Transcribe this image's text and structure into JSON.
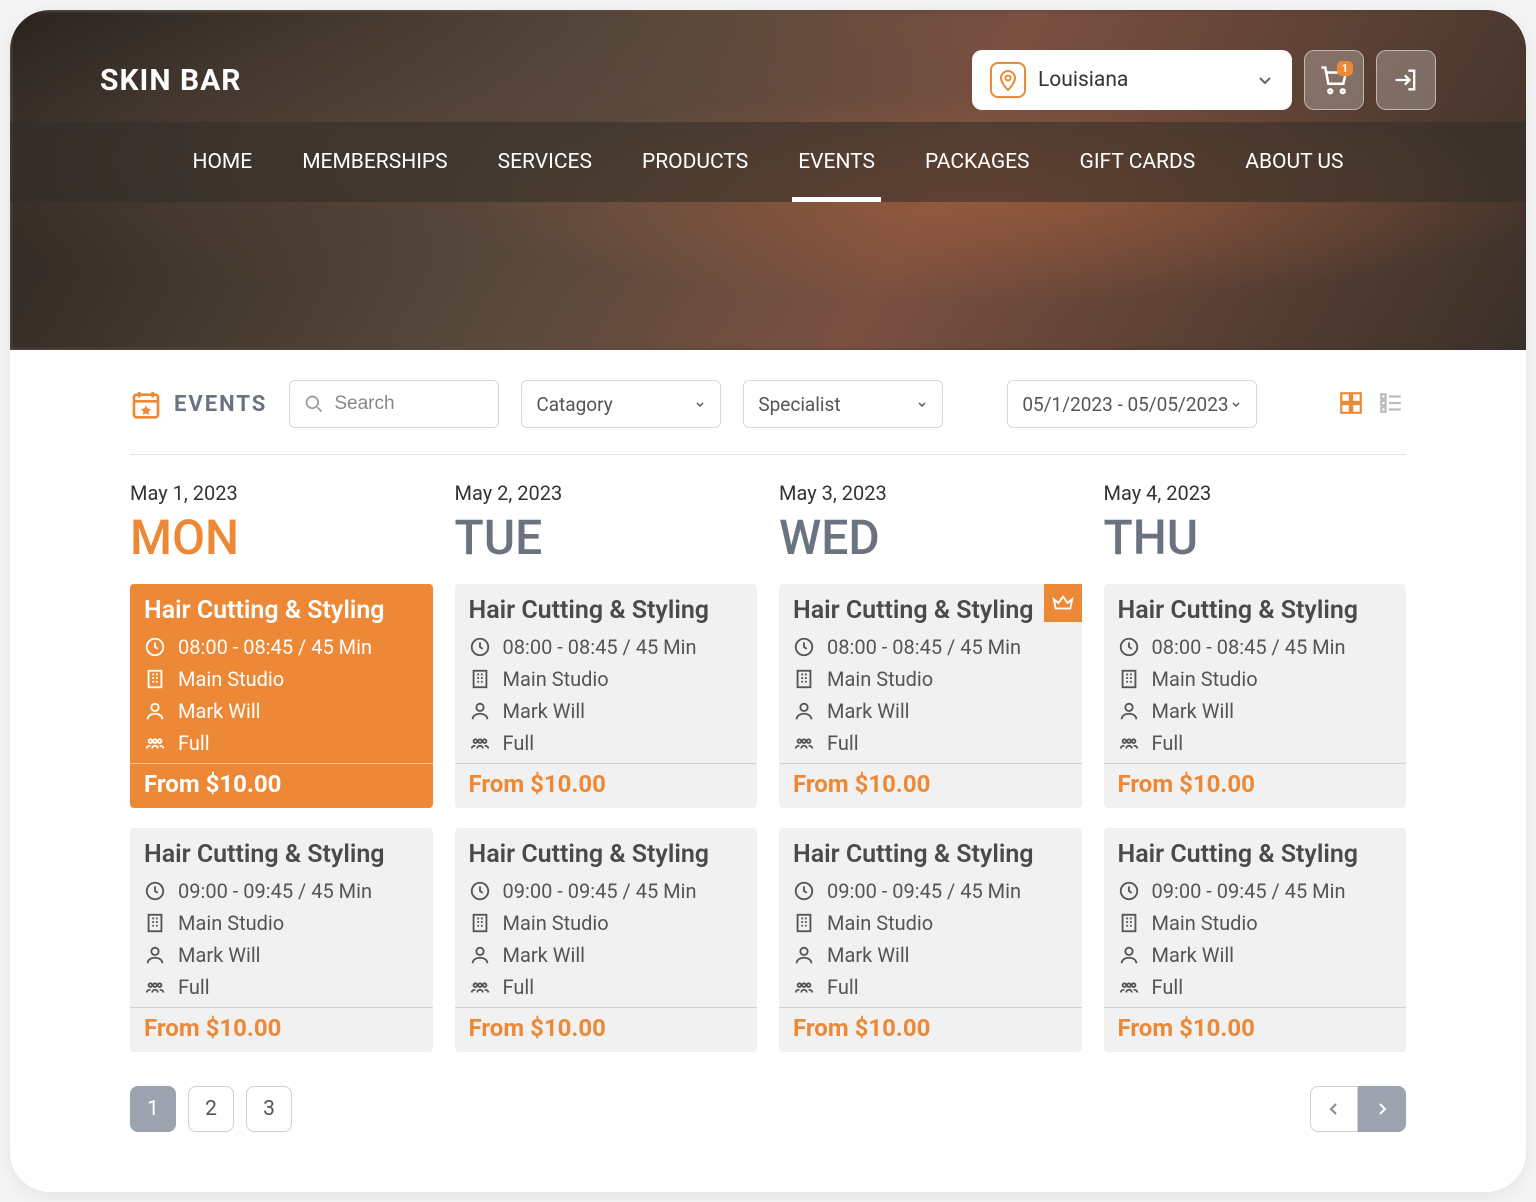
{
  "brand": "SKIN BAR",
  "location": {
    "selected": "Louisiana"
  },
  "cart": {
    "count": "1"
  },
  "nav": {
    "items": [
      "HOME",
      "MEMBERSHIPS",
      "SERVICES",
      "PRODUCTS",
      "EVENTS",
      "PACKAGES",
      "GIFT CARDS",
      "ABOUT US"
    ],
    "active_index": 4
  },
  "filters": {
    "title": "EVENTS",
    "search_placeholder": "Search",
    "category_label": "Catagory",
    "specialist_label": "Specialist",
    "date_range": "05/1/2023 - 05/05/2023"
  },
  "days": [
    {
      "date": "May 1, 2023",
      "name": "MON",
      "today": true
    },
    {
      "date": "May 2, 2023",
      "name": "TUE",
      "today": false
    },
    {
      "date": "May 3, 2023",
      "name": "WED",
      "today": false
    },
    {
      "date": "May 4, 2023",
      "name": "THU",
      "today": false
    }
  ],
  "event_template": {
    "title": "Hair Cutting & Styling",
    "time_a": "08:00 - 08:45 / 45 Min",
    "time_b": "09:00 - 09:45 / 45 Min",
    "studio": "Main Studio",
    "specialist": "Mark Will",
    "capacity": "Full",
    "price": "From $10.00"
  },
  "pagination": {
    "pages": [
      "1",
      "2",
      "3"
    ],
    "active": 0
  }
}
